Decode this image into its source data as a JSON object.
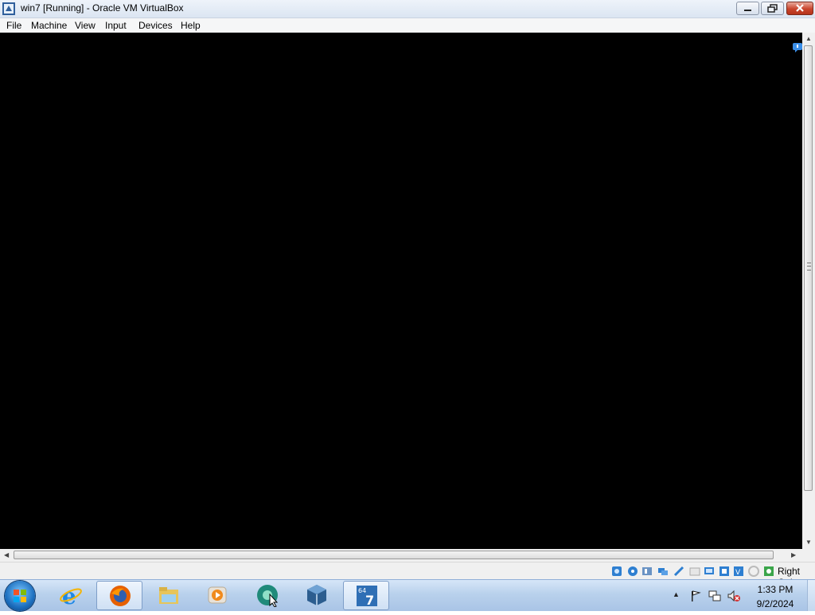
{
  "window": {
    "title": "win7 [Running] - Oracle VM VirtualBox",
    "menu": [
      "File",
      "Machine",
      "View",
      "Input",
      "Devices",
      "Help"
    ]
  },
  "vm_display": {
    "content": "black",
    "accent": "#000000"
  },
  "statusbar": {
    "icons": [
      "hard-disk-icon",
      "optical-drive-icon",
      "audio-icon",
      "network-icon",
      "usb-icon",
      "shared-folders-icon",
      "display-icon",
      "video-capture-icon",
      "virtualization-icon",
      "mouse-integration-icon",
      "keyboard-icon"
    ],
    "host_key": "Right Ctrl"
  },
  "taskbar": {
    "apps": [
      {
        "name": "internet-explorer-icon",
        "active": false
      },
      {
        "name": "firefox-icon",
        "active": true
      },
      {
        "name": "file-explorer-icon",
        "active": false
      },
      {
        "name": "media-player-icon",
        "active": false
      },
      {
        "name": "green-app-icon",
        "active": false
      },
      {
        "name": "virtualbox-icon",
        "active": false
      },
      {
        "name": "win7-vm-icon",
        "active": true
      }
    ],
    "tray": [
      "show-hidden-icons-arrow",
      "action-center-flag-icon",
      "network-icon",
      "volume-muted-icon"
    ],
    "clock": {
      "time": "1:33 PM",
      "date": "9/2/2024"
    }
  }
}
